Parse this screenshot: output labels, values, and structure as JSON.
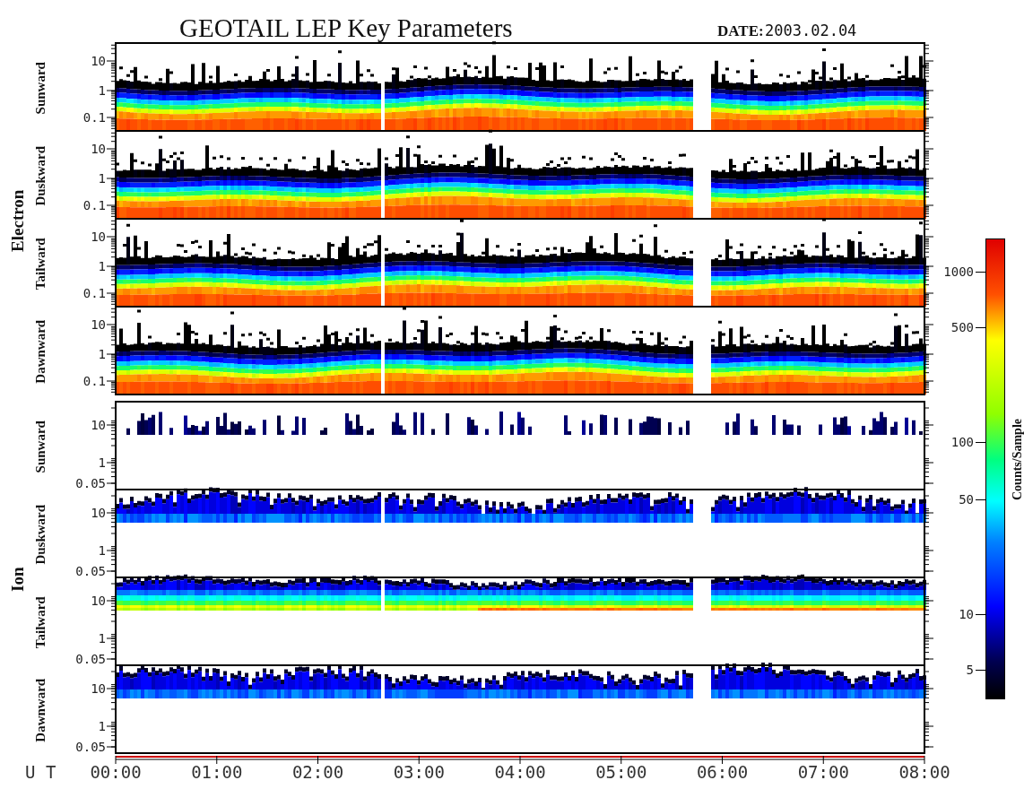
{
  "title": "GEOTAIL LEP Key Parameters",
  "date_label": "DATE:",
  "date": "2003.02.04",
  "groups": [
    {
      "label": "Electron",
      "panels": [
        {
          "label": "Sunward",
          "kind": "electron",
          "yticks": [
            "10",
            "1",
            "0.1"
          ]
        },
        {
          "label": "Duskward",
          "kind": "electron",
          "yticks": [
            "10",
            "1",
            "0.1"
          ]
        },
        {
          "label": "Tailward",
          "kind": "electron",
          "yticks": [
            "10",
            "1",
            "0.1"
          ]
        },
        {
          "label": "Dawnward",
          "kind": "electron",
          "yticks": [
            "10",
            "1",
            "0.1"
          ]
        }
      ]
    },
    {
      "label": "Ion",
      "panels": [
        {
          "label": "Sunward",
          "kind": "ion-sparse",
          "yticks": [
            "10",
            "1",
            "0.05"
          ]
        },
        {
          "label": "Duskward",
          "kind": "ion",
          "yticks": [
            "10",
            "1",
            "0.05"
          ]
        },
        {
          "label": "Tailward",
          "kind": "ion-hot",
          "yticks": [
            "10",
            "1",
            "0.05"
          ]
        },
        {
          "label": "Dawnward",
          "kind": "ion",
          "yticks": [
            "10",
            "1",
            "0.05"
          ]
        }
      ]
    }
  ],
  "x_axis": {
    "label": "U T",
    "ticks": [
      "00:00",
      "01:00",
      "02:00",
      "03:00",
      "04:00",
      "05:00",
      "06:00",
      "07:00",
      "08:00"
    ]
  },
  "colorbar": {
    "title": "Counts/Sample",
    "ticks": [
      "1000",
      "500",
      "100",
      "50",
      "10",
      "5"
    ]
  }
}
